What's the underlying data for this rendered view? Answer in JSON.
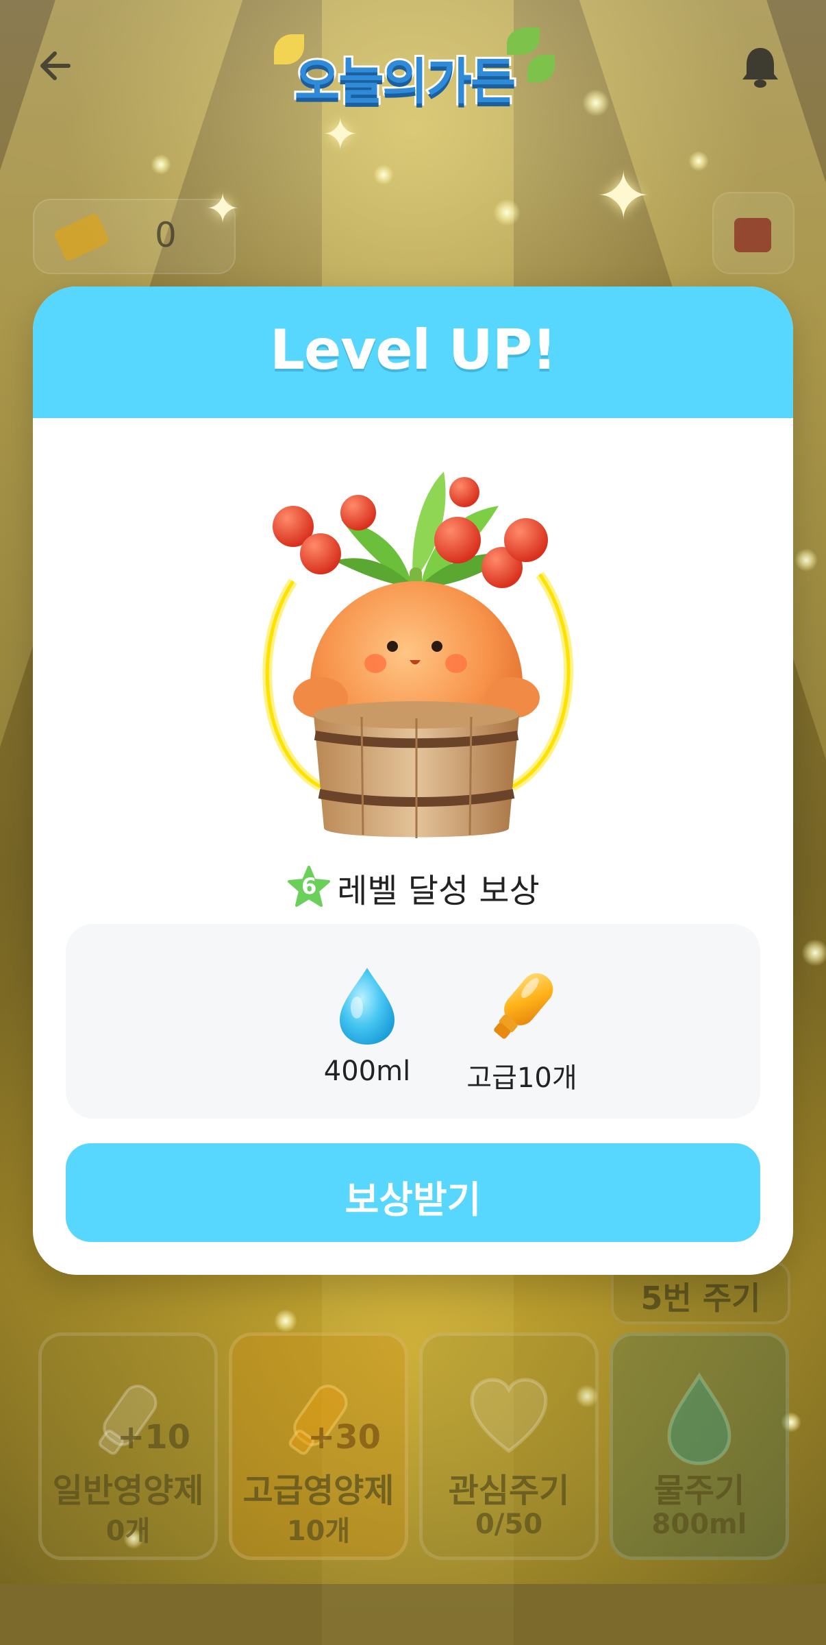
{
  "app": {
    "logo_text": "오늘의가든",
    "back_icon": "arrow-left-icon",
    "bell_icon": "bell-icon"
  },
  "status_bar": {
    "ticket_count": "0"
  },
  "actions": {
    "watering_chip_label": "5번 주기",
    "items": [
      {
        "label": "일반영양제",
        "badge": "+10",
        "count": "0개",
        "icon": "normal-fertilizer-icon"
      },
      {
        "label": "고급영양제",
        "badge": "+30",
        "count": "10개",
        "icon": "premium-fertilizer-icon"
      },
      {
        "label": "관심주기",
        "badge": "",
        "count": "0/50",
        "icon": "heart-icon"
      },
      {
        "label": "물주기",
        "badge": "",
        "count": "800ml",
        "icon": "water-drop-icon"
      }
    ]
  },
  "modal": {
    "title": "Level UP!",
    "level": "6",
    "subtitle": "레벨 달성 보상",
    "rewards": [
      {
        "label": "400ml",
        "icon": "water-drop-icon"
      },
      {
        "label": "고급10개",
        "icon": "premium-fertilizer-icon"
      }
    ],
    "claim_button": "보상받기"
  },
  "colors": {
    "accent": "#58d7fe",
    "level_star": "#6ad05a"
  }
}
